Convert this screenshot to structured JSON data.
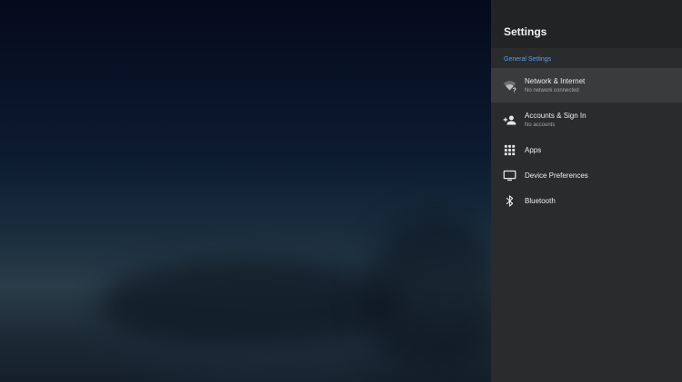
{
  "panel": {
    "title": "Settings",
    "section_label": "General Settings"
  },
  "menu": {
    "items": [
      {
        "label": "Network & Internet",
        "sublabel": "No network connected",
        "icon": "wifi-question-icon"
      },
      {
        "label": "Accounts & Sign In",
        "sublabel": "No accounts",
        "icon": "add-person-icon"
      },
      {
        "label": "Apps",
        "icon": "apps-grid-icon"
      },
      {
        "label": "Device Preferences",
        "icon": "tv-icon"
      },
      {
        "label": "Bluetooth",
        "icon": "bluetooth-icon"
      }
    ]
  },
  "colors": {
    "panel_bg": "#2a2b2d",
    "header_bg": "#222325",
    "accent": "#5aa0e6",
    "focused_item_bg": "#3a3b3d"
  }
}
